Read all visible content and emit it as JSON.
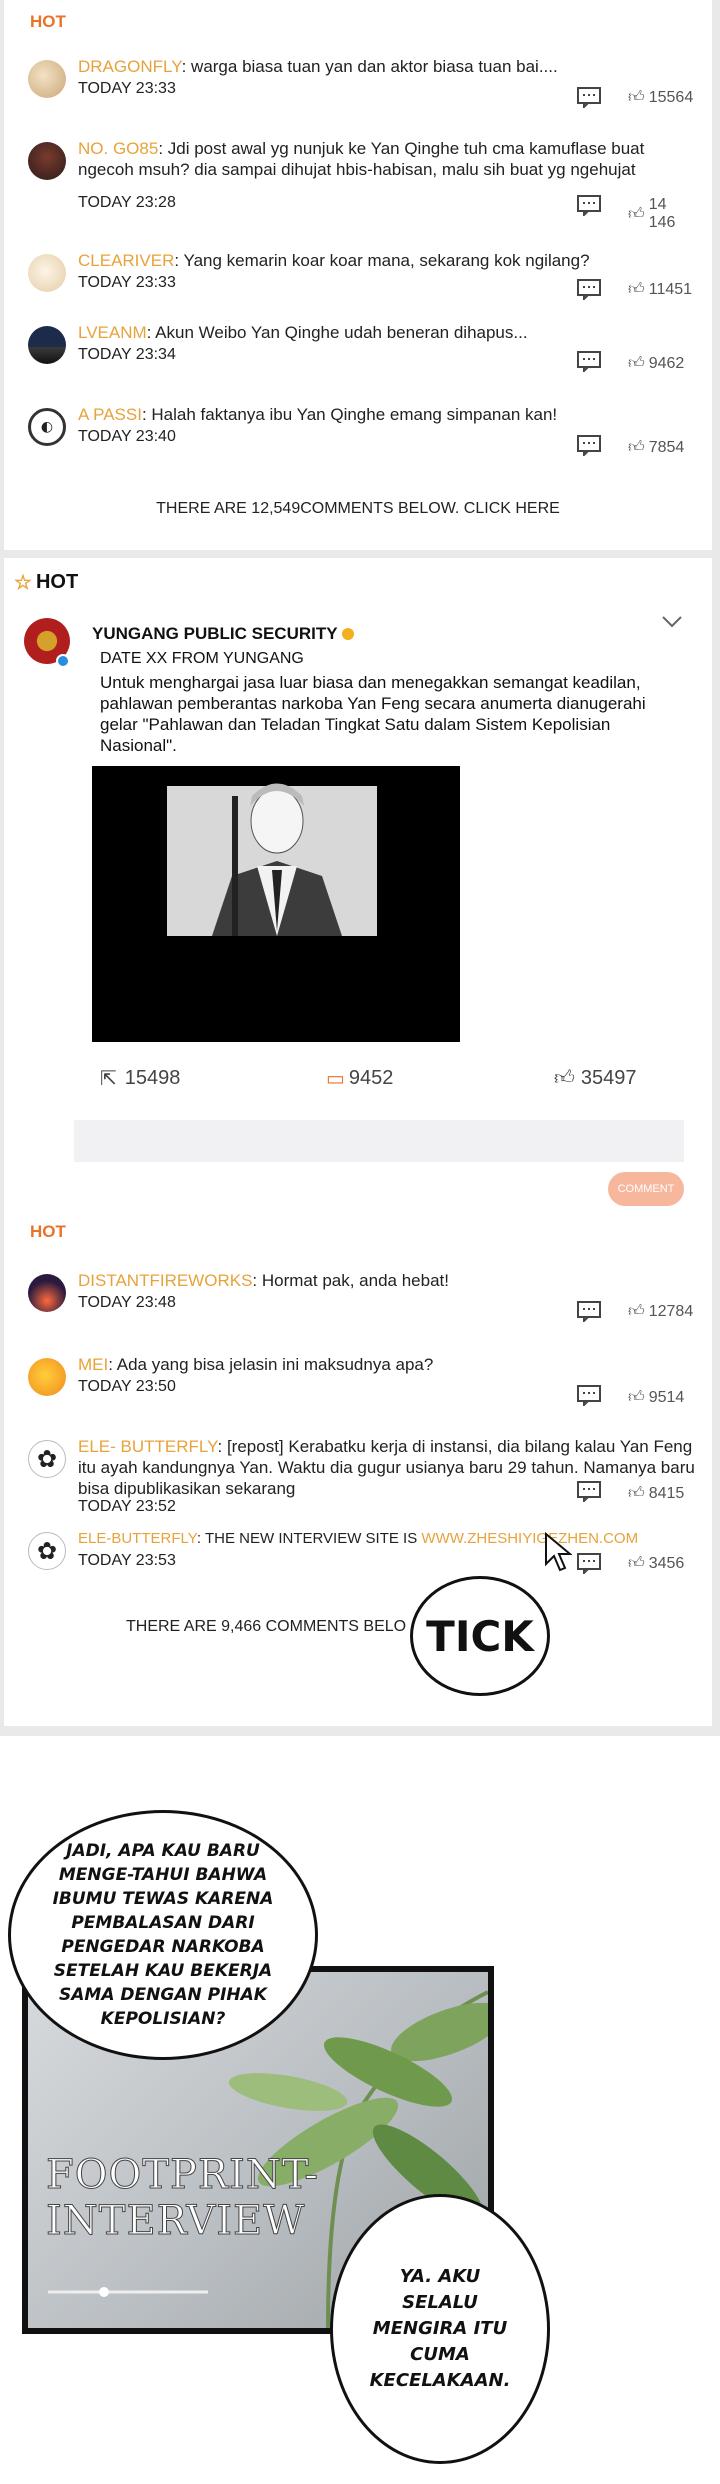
{
  "panel1": {
    "hot_label": "HOT",
    "comments": [
      {
        "user": "DRAGONFLY",
        "text": ": warga biasa tuan yan dan aktor biasa tuan bai....",
        "time": "TODAY 23:33",
        "likes": "15564"
      },
      {
        "user": "NO. GO85",
        "text": ": Jdi post awal yg nunjuk ke Yan Qinghe tuh cma kamuflase buat ngecoh msuh? dia sampai dihujat hbis-habisan, malu sih buat yg ngehujat",
        "time": "TODAY 23:28",
        "likes": "14 146"
      },
      {
        "user": "CLEARIVER",
        "text": ": Yang kemarin koar koar mana, sekarang kok ngilang?",
        "time": "TODAY 23:33",
        "likes": "11451"
      },
      {
        "user": "LVEANM",
        "text": ": Akun Weibo Yan Qinghe udah beneran dihapus...",
        "time": "TODAY 23:34",
        "likes": "9462"
      },
      {
        "user": "A PASSI",
        "text": ": Halah faktanya ibu Yan Qinghe emang simpanan kan!",
        "time": "TODAY 23:40",
        "likes": "7854"
      }
    ],
    "below_text": "THERE ARE 12,549COMMENTS BELOW. CLICK HERE"
  },
  "panel2": {
    "hot_label": "HOT",
    "post": {
      "account": "YUNGANG PUBLIC SECURITY",
      "date_line": "DATE XX FROM YUNGANG",
      "body": "Untuk menghargai jasa luar biasa dan menegakkan semangat keadilan, pahlawan pemberantas narkoba Yan Feng secara anumerta dianugerahi gelar \"Pahlawan dan Teladan Tingkat Satu dalam Sistem Kepolisian Nasional\".",
      "shares": "15498",
      "comments": "9452",
      "likes": "35497",
      "comment_button": "COMMENT"
    },
    "hot_label_2": "HOT",
    "comments": [
      {
        "user": "DISTANTFIREWORKS",
        "text": ": Hormat pak, anda hebat!",
        "time": "TODAY 23:48",
        "likes": "12784"
      },
      {
        "user": "MEI",
        "text": ": Ada yang bisa jelasin ini maksudnya apa?",
        "time": "TODAY 23:50",
        "likes": "9514"
      },
      {
        "user": "ELE- BUTTERFLY",
        "text": ": [repost] Kerabatku kerja di instansi, dia bilang kalau Yan Feng itu ayah kandungnya Yan. Waktu dia gugur usianya baru 29 tahun. Namanya baru bisa dipublikasikan sekarang",
        "time": "TODAY 23:52",
        "likes": "8415"
      },
      {
        "user": "ELE-BUTTERFLY",
        "text": ": THE NEW INTERVIEW SITE IS ",
        "link": "WWW.ZHESHIYIGEZHEN.COM",
        "time": "TODAY 23:53",
        "likes": "3456"
      }
    ],
    "below_text": "THERE ARE 9,466 COMMENTS BELO",
    "sfx": "TICK"
  },
  "manga": {
    "bubble1": "JADI, APA KAU BARU MENGE-TAHUI BAHWA IBUMU TEWAS KARENA PEMBALASAN DARI PENGEDAR NARKOBA SETELAH KAU BEKERJA SAMA DENGAN PIHAK KEPOLISIAN?",
    "screen_caption": "FOOTPRINT-INTERVIEW",
    "bubble2": "YA. AKU SELALU MENGIRA ITU CUMA KECELAKAAN."
  },
  "colors": {
    "username": "#e8a23a",
    "hot": "#e8732a",
    "link": "#e8a23a",
    "comment_button": "#f7b79c"
  }
}
